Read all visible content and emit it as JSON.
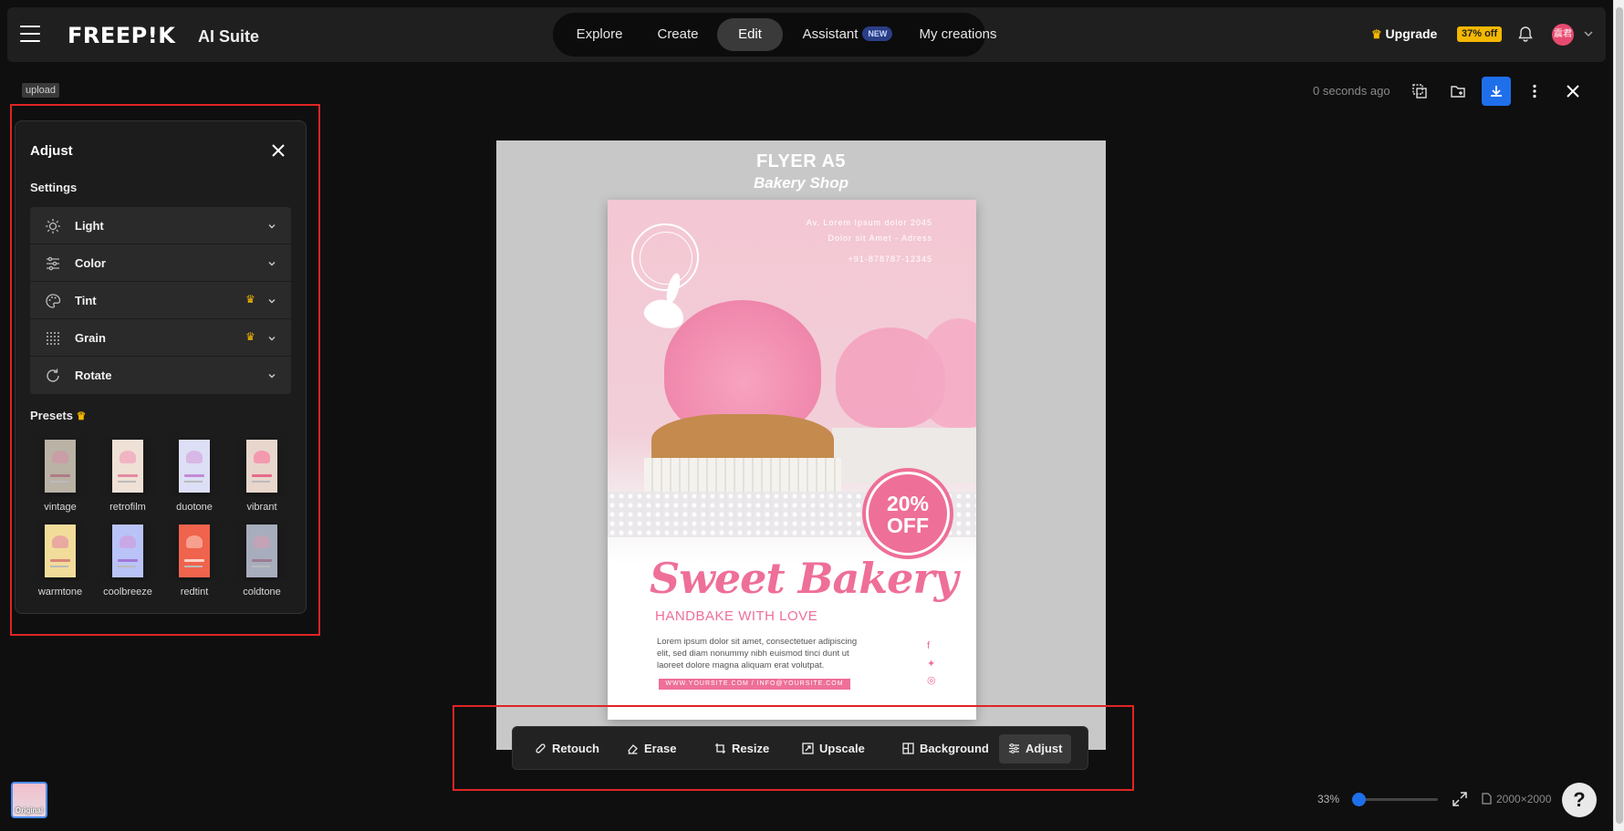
{
  "brand": {
    "logo": "FREEP!K",
    "suite": "AI Suite"
  },
  "nav": {
    "items": [
      {
        "label": "Explore"
      },
      {
        "label": "Create"
      },
      {
        "label": "Edit"
      },
      {
        "label": "Assistant",
        "badge": "NEW"
      },
      {
        "label": "My creations"
      }
    ],
    "active": "Edit"
  },
  "header": {
    "upgrade_label": "Upgrade",
    "discount": "37% off",
    "avatar_text": "震君"
  },
  "workspace": {
    "upload_tag": "upload",
    "timestamp": "0 seconds ago"
  },
  "adjust_panel": {
    "title": "Adjust",
    "settings_label": "Settings",
    "settings": [
      {
        "label": "Light",
        "icon": "sun-icon",
        "premium": false
      },
      {
        "label": "Color",
        "icon": "sliders-icon",
        "premium": false
      },
      {
        "label": "Tint",
        "icon": "palette-icon",
        "premium": true
      },
      {
        "label": "Grain",
        "icon": "grain-icon",
        "premium": true
      },
      {
        "label": "Rotate",
        "icon": "rotate-icon",
        "premium": false
      }
    ],
    "presets_label": "Presets",
    "presets": [
      {
        "name": "vintage",
        "tint": "#b9b2a5"
      },
      {
        "name": "retrofilm",
        "tint": "#efe1d6"
      },
      {
        "name": "duotone",
        "tint": "#dcdff5"
      },
      {
        "name": "vibrant",
        "tint": "#e8d6cc"
      },
      {
        "name": "warmtone",
        "tint": "#f2dc9a"
      },
      {
        "name": "coolbreeze",
        "tint": "#b9c3f7"
      },
      {
        "name": "redtint",
        "tint": "#f0634c"
      },
      {
        "name": "coldtone",
        "tint": "#a8adbd"
      }
    ]
  },
  "canvas": {
    "heading": "FLYER A5",
    "subheading": "Bakery Shop",
    "address_lines": [
      "Av. Lorem Ipsum dolor 2045",
      "Dolor sit Amet - Adress",
      "+91-878787-12345"
    ],
    "offer": "20% OFF",
    "title": "Sweet Bakery",
    "tagline": "HANDBAKE WITH LOVE",
    "body": "Lorem ipsum dolor sit amet, consectetuer adipiscing elit, sed diam nonummy nibh euismod tinci dunt ut laoreet dolore magna aliquam erat volutpat.",
    "footer": "WWW.YOURSITE.COM / INFO@YOURSITE.COM"
  },
  "toolbar": {
    "items": [
      {
        "label": "Retouch"
      },
      {
        "label": "Erase"
      },
      {
        "label": "Resize"
      },
      {
        "label": "Upscale"
      },
      {
        "label": "Background"
      },
      {
        "label": "Adjust"
      }
    ],
    "active": "Adjust"
  },
  "footer": {
    "zoom": "33%",
    "zoom_fraction": 0.0,
    "dimensions": "2000×2000",
    "original_label": "Original",
    "help": "?"
  },
  "colors": {
    "accent": "#1f6feb",
    "premium": "#f5b800",
    "highlight": "#e02424"
  }
}
